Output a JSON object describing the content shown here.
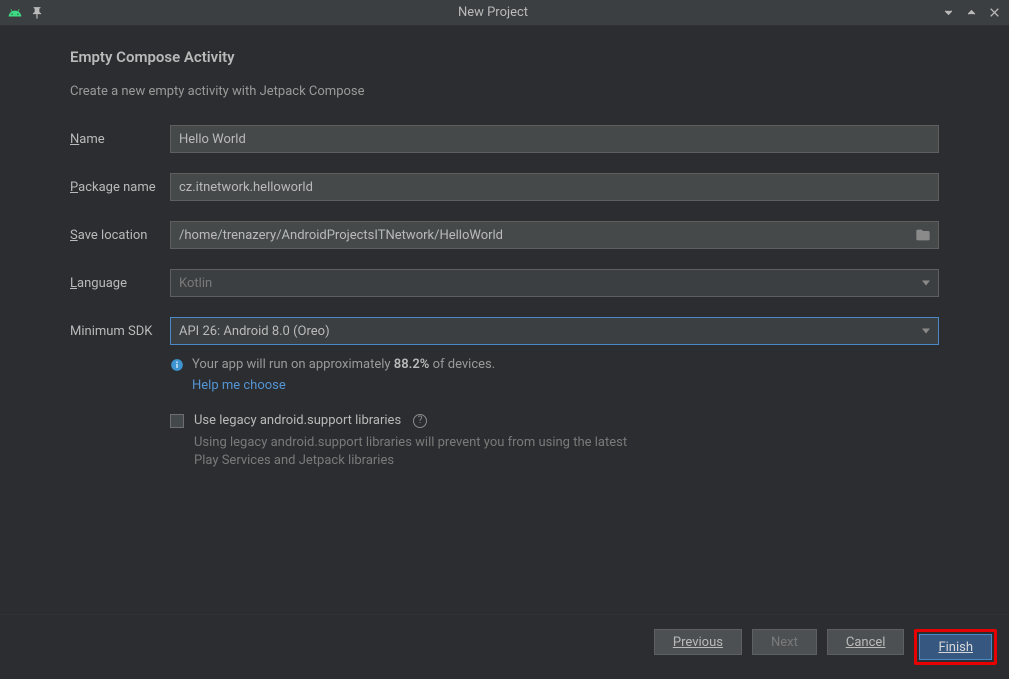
{
  "titlebar": {
    "title": "New Project"
  },
  "heading": "Empty Compose Activity",
  "subtitle": "Create a new empty activity with Jetpack Compose",
  "form": {
    "name": {
      "label": "Name",
      "value": "Hello World"
    },
    "package": {
      "label": "Package name",
      "value": "cz.itnetwork.helloworld"
    },
    "location": {
      "label": "Save location",
      "value": "/home/trenazery/AndroidProjectsITNetwork/HelloWorld"
    },
    "language": {
      "label": "Language",
      "value": "Kotlin"
    },
    "minsdk": {
      "label": "Minimum SDK",
      "value": "API 26: Android 8.0 (Oreo)"
    }
  },
  "info": {
    "text_pre": "Your app will run on approximately ",
    "text_bold": "88.2%",
    "text_post": " of devices.",
    "help_link": "Help me choose"
  },
  "legacy": {
    "label": "Use legacy android.support libraries",
    "desc": "Using legacy android.support libraries will prevent you from using the latest Play Services and Jetpack libraries"
  },
  "buttons": {
    "previous": "Previous",
    "next": "Next",
    "cancel": "Cancel",
    "finish": "Finish"
  }
}
